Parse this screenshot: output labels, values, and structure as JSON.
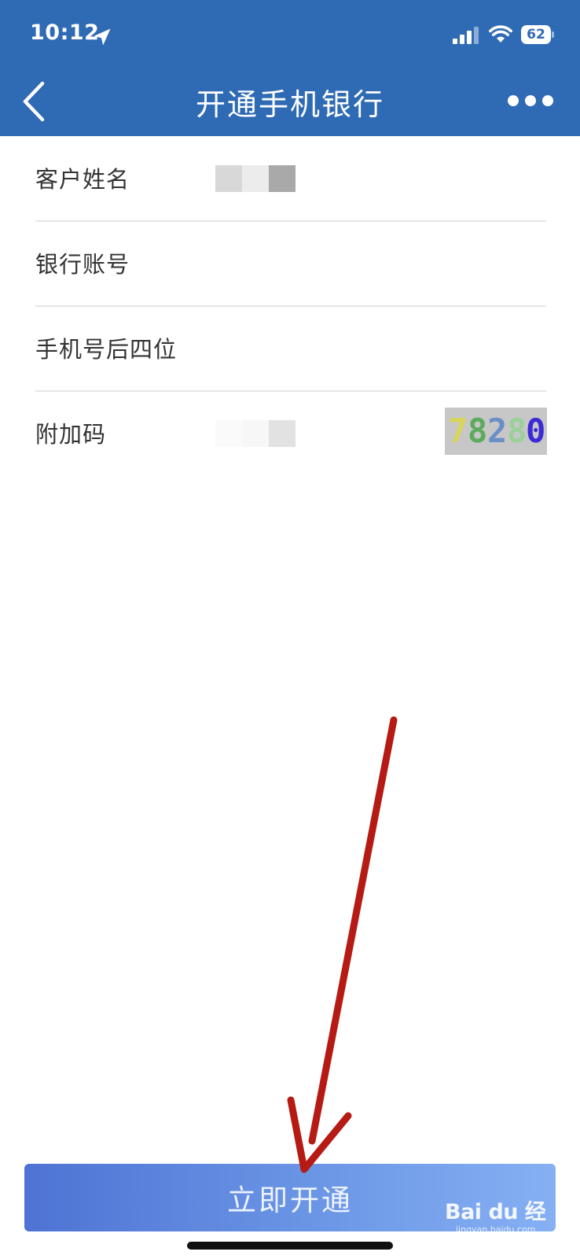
{
  "status_bar": {
    "time": "10:12",
    "battery_level": "62"
  },
  "header": {
    "title": "开通手机银行",
    "background_color": "#2f6ab4"
  },
  "form": {
    "fields": [
      {
        "label": "客户姓名",
        "value": "",
        "masked": true
      },
      {
        "label": "银行账号",
        "value": "",
        "placeholder": ""
      },
      {
        "label": "手机号后四位",
        "value": "",
        "placeholder": ""
      },
      {
        "label": "附加码",
        "value": "",
        "masked": true
      }
    ],
    "captcha": {
      "chars": [
        "7",
        "8",
        "2",
        "8",
        "0"
      ],
      "colors": [
        "#d6d65a",
        "#5cab5c",
        "#6a8fc7",
        "#9bd09b",
        "#3b2ad6"
      ]
    }
  },
  "submit_button": {
    "label": "立即开通"
  },
  "watermark": {
    "text": "Bai du 经验",
    "sub": "jingyan.baidu.com"
  },
  "icons": {
    "back": "chevron-left-icon",
    "more": "more-dots-icon",
    "location": "location-arrow-icon",
    "signal": "cellular-signal-icon",
    "wifi": "wifi-icon",
    "battery": "battery-icon"
  }
}
